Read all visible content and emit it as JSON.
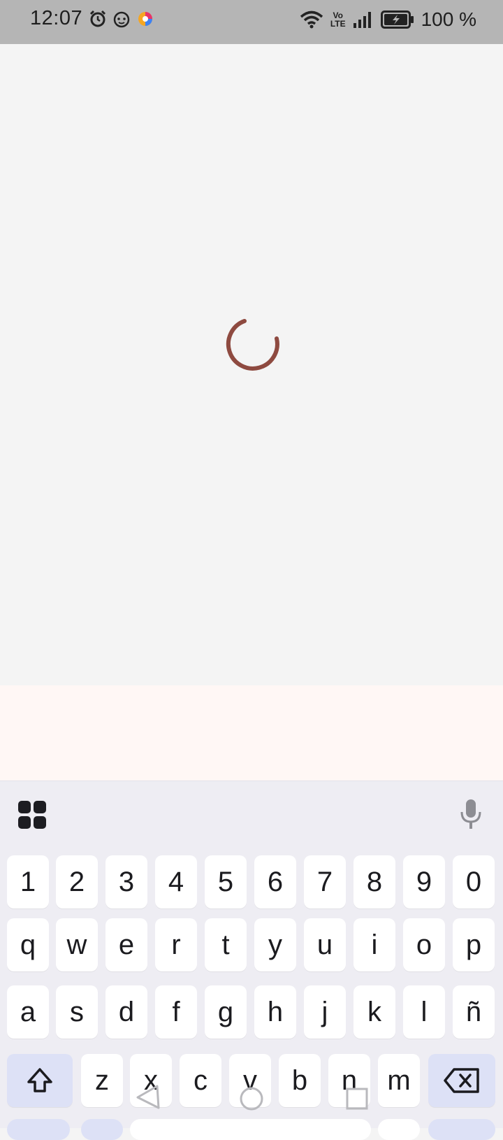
{
  "status_bar": {
    "time": "12:07",
    "battery": "100 %",
    "network_badge": [
      "Vo",
      "LTE"
    ],
    "icons": [
      "alarm-icon",
      "cat-face-icon",
      "color-ring-app-icon",
      "wifi-icon",
      "volte-icon",
      "signal-icon",
      "battery-charging-icon"
    ]
  },
  "main": {
    "loading_indicator": "spinner",
    "accent_color": "#8e4a40"
  },
  "keyboard": {
    "toolbar": {
      "left_icon": "apps-grid-icon",
      "right_icon": "microphone-icon"
    },
    "number_row": [
      "1",
      "2",
      "3",
      "4",
      "5",
      "6",
      "7",
      "8",
      "9",
      "0"
    ],
    "row1": [
      "q",
      "w",
      "e",
      "r",
      "t",
      "y",
      "u",
      "i",
      "o",
      "p"
    ],
    "row2": [
      "a",
      "s",
      "d",
      "f",
      "g",
      "h",
      "j",
      "k",
      "l",
      "ñ"
    ],
    "row3": [
      "z",
      "x",
      "c",
      "v",
      "b",
      "n",
      "m"
    ],
    "shift_icon": "shift-icon",
    "backspace_icon": "backspace-icon"
  },
  "navigation_bar": {
    "buttons": [
      "back-triangle-icon",
      "home-circle-icon",
      "recents-square-icon"
    ]
  }
}
